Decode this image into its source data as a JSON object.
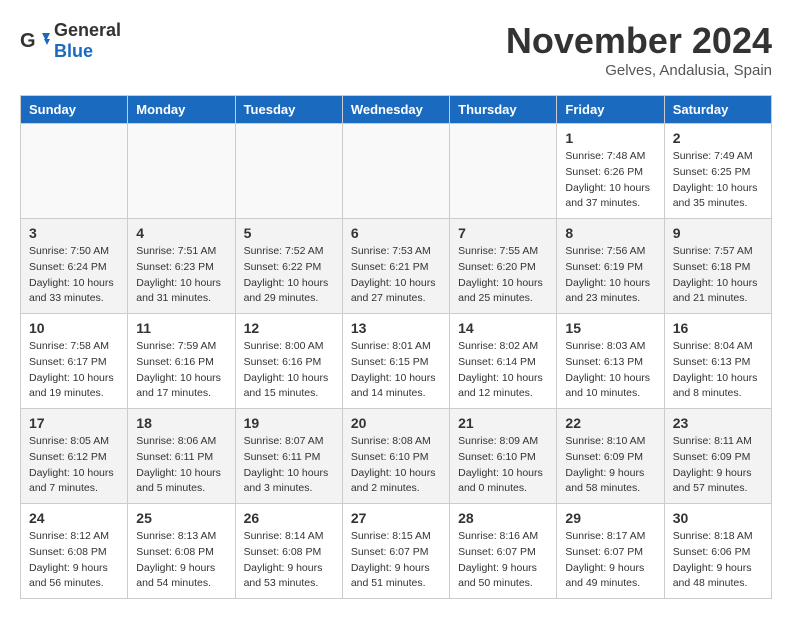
{
  "header": {
    "logo_general": "General",
    "logo_blue": "Blue",
    "month": "November 2024",
    "location": "Gelves, Andalusia, Spain"
  },
  "weekdays": [
    "Sunday",
    "Monday",
    "Tuesday",
    "Wednesday",
    "Thursday",
    "Friday",
    "Saturday"
  ],
  "weeks": [
    [
      {
        "day": "",
        "info": ""
      },
      {
        "day": "",
        "info": ""
      },
      {
        "day": "",
        "info": ""
      },
      {
        "day": "",
        "info": ""
      },
      {
        "day": "",
        "info": ""
      },
      {
        "day": "1",
        "info": "Sunrise: 7:48 AM\nSunset: 6:26 PM\nDaylight: 10 hours and 37 minutes."
      },
      {
        "day": "2",
        "info": "Sunrise: 7:49 AM\nSunset: 6:25 PM\nDaylight: 10 hours and 35 minutes."
      }
    ],
    [
      {
        "day": "3",
        "info": "Sunrise: 7:50 AM\nSunset: 6:24 PM\nDaylight: 10 hours and 33 minutes."
      },
      {
        "day": "4",
        "info": "Sunrise: 7:51 AM\nSunset: 6:23 PM\nDaylight: 10 hours and 31 minutes."
      },
      {
        "day": "5",
        "info": "Sunrise: 7:52 AM\nSunset: 6:22 PM\nDaylight: 10 hours and 29 minutes."
      },
      {
        "day": "6",
        "info": "Sunrise: 7:53 AM\nSunset: 6:21 PM\nDaylight: 10 hours and 27 minutes."
      },
      {
        "day": "7",
        "info": "Sunrise: 7:55 AM\nSunset: 6:20 PM\nDaylight: 10 hours and 25 minutes."
      },
      {
        "day": "8",
        "info": "Sunrise: 7:56 AM\nSunset: 6:19 PM\nDaylight: 10 hours and 23 minutes."
      },
      {
        "day": "9",
        "info": "Sunrise: 7:57 AM\nSunset: 6:18 PM\nDaylight: 10 hours and 21 minutes."
      }
    ],
    [
      {
        "day": "10",
        "info": "Sunrise: 7:58 AM\nSunset: 6:17 PM\nDaylight: 10 hours and 19 minutes."
      },
      {
        "day": "11",
        "info": "Sunrise: 7:59 AM\nSunset: 6:16 PM\nDaylight: 10 hours and 17 minutes."
      },
      {
        "day": "12",
        "info": "Sunrise: 8:00 AM\nSunset: 6:16 PM\nDaylight: 10 hours and 15 minutes."
      },
      {
        "day": "13",
        "info": "Sunrise: 8:01 AM\nSunset: 6:15 PM\nDaylight: 10 hours and 14 minutes."
      },
      {
        "day": "14",
        "info": "Sunrise: 8:02 AM\nSunset: 6:14 PM\nDaylight: 10 hours and 12 minutes."
      },
      {
        "day": "15",
        "info": "Sunrise: 8:03 AM\nSunset: 6:13 PM\nDaylight: 10 hours and 10 minutes."
      },
      {
        "day": "16",
        "info": "Sunrise: 8:04 AM\nSunset: 6:13 PM\nDaylight: 10 hours and 8 minutes."
      }
    ],
    [
      {
        "day": "17",
        "info": "Sunrise: 8:05 AM\nSunset: 6:12 PM\nDaylight: 10 hours and 7 minutes."
      },
      {
        "day": "18",
        "info": "Sunrise: 8:06 AM\nSunset: 6:11 PM\nDaylight: 10 hours and 5 minutes."
      },
      {
        "day": "19",
        "info": "Sunrise: 8:07 AM\nSunset: 6:11 PM\nDaylight: 10 hours and 3 minutes."
      },
      {
        "day": "20",
        "info": "Sunrise: 8:08 AM\nSunset: 6:10 PM\nDaylight: 10 hours and 2 minutes."
      },
      {
        "day": "21",
        "info": "Sunrise: 8:09 AM\nSunset: 6:10 PM\nDaylight: 10 hours and 0 minutes."
      },
      {
        "day": "22",
        "info": "Sunrise: 8:10 AM\nSunset: 6:09 PM\nDaylight: 9 hours and 58 minutes."
      },
      {
        "day": "23",
        "info": "Sunrise: 8:11 AM\nSunset: 6:09 PM\nDaylight: 9 hours and 57 minutes."
      }
    ],
    [
      {
        "day": "24",
        "info": "Sunrise: 8:12 AM\nSunset: 6:08 PM\nDaylight: 9 hours and 56 minutes."
      },
      {
        "day": "25",
        "info": "Sunrise: 8:13 AM\nSunset: 6:08 PM\nDaylight: 9 hours and 54 minutes."
      },
      {
        "day": "26",
        "info": "Sunrise: 8:14 AM\nSunset: 6:08 PM\nDaylight: 9 hours and 53 minutes."
      },
      {
        "day": "27",
        "info": "Sunrise: 8:15 AM\nSunset: 6:07 PM\nDaylight: 9 hours and 51 minutes."
      },
      {
        "day": "28",
        "info": "Sunrise: 8:16 AM\nSunset: 6:07 PM\nDaylight: 9 hours and 50 minutes."
      },
      {
        "day": "29",
        "info": "Sunrise: 8:17 AM\nSunset: 6:07 PM\nDaylight: 9 hours and 49 minutes."
      },
      {
        "day": "30",
        "info": "Sunrise: 8:18 AM\nSunset: 6:06 PM\nDaylight: 9 hours and 48 minutes."
      }
    ]
  ]
}
